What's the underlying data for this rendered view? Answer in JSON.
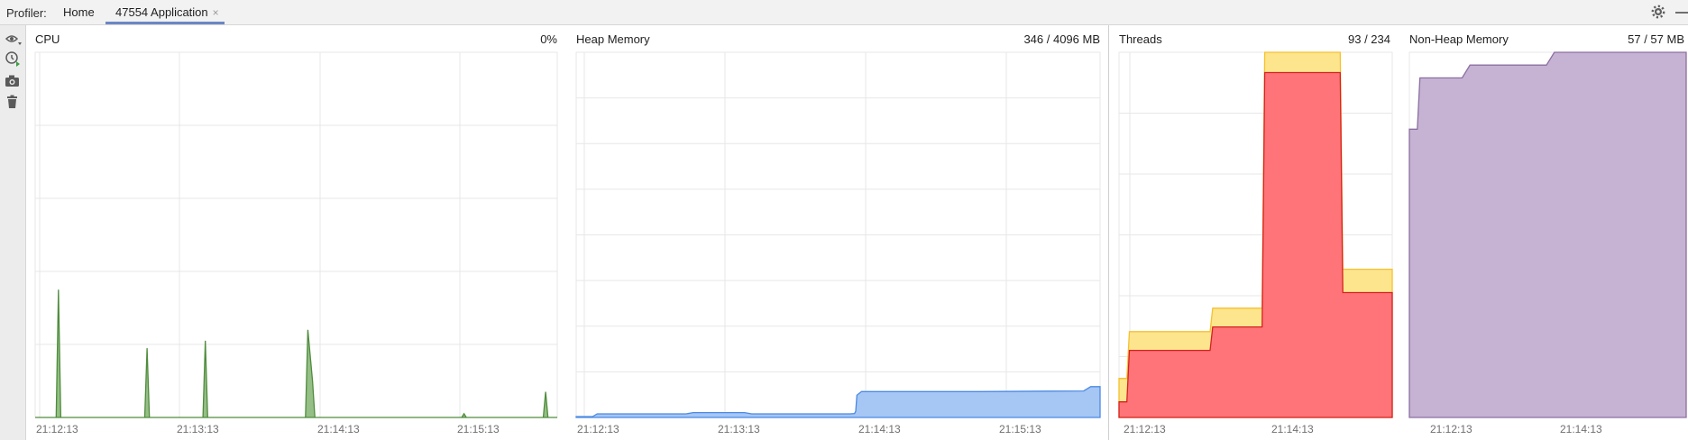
{
  "topbar": {
    "profiler_label": "Profiler:",
    "tabs": [
      {
        "label": "Home"
      },
      {
        "label": "47554 Application",
        "closable": true,
        "active": true
      }
    ],
    "close_glyph": "×"
  },
  "toolbar": {
    "icons": [
      "eye-dropdown-icon",
      "cpu-record-icon",
      "camera-icon",
      "trash-icon"
    ]
  },
  "colors": {
    "cpu_fill": "#95bf87",
    "cpu_line": "#4f8c3c",
    "heap_fill": "#a6c6f4",
    "heap_line": "#4a8ae4",
    "threads_total_fill": "#fde58e",
    "threads_total_line": "#f5c12e",
    "threads_live_fill": "#ff7478",
    "threads_live_line": "#d42121",
    "nonheap_fill": "#c6b2d2",
    "nonheap_line": "#8c6fa2",
    "grid": "#e7e7e7"
  },
  "panels": {
    "cpu": {
      "title": "CPU",
      "value": "0%",
      "ticks": [
        "21:12:13",
        "21:13:13",
        "21:14:13",
        "21:15:13"
      ]
    },
    "heap": {
      "title": "Heap Memory",
      "value": "346 / 4096 MB",
      "ticks": [
        "21:12:13",
        "21:13:13",
        "21:14:13",
        "21:15:13"
      ]
    },
    "threads": {
      "title": "Threads",
      "value": "93 / 234",
      "ticks": [
        "21:12:13",
        "21:14:13"
      ]
    },
    "nonheap": {
      "title": "Non-Heap Memory",
      "value": "57 / 57 MB",
      "ticks": [
        "21:12:13",
        "21:14:13"
      ]
    }
  },
  "chart_data": [
    {
      "type": "area",
      "name": "cpu",
      "unit": "percent",
      "x_unit": "seconds since 21:12:13",
      "xlim": [
        -2,
        222
      ],
      "ylim": [
        0,
        100
      ],
      "points": [
        [
          -2,
          0
        ],
        [
          7,
          0
        ],
        [
          8,
          35
        ],
        [
          9,
          0
        ],
        [
          45,
          0
        ],
        [
          46,
          19
        ],
        [
          47,
          0
        ],
        [
          70,
          0
        ],
        [
          71,
          21
        ],
        [
          72,
          0
        ],
        [
          114,
          0
        ],
        [
          115,
          24
        ],
        [
          117,
          10
        ],
        [
          118,
          0
        ],
        [
          181,
          0
        ],
        [
          182,
          1
        ],
        [
          183,
          0
        ],
        [
          216,
          0
        ],
        [
          217,
          7
        ],
        [
          218,
          0
        ],
        [
          222,
          0
        ]
      ]
    },
    {
      "type": "area",
      "name": "heap",
      "unit": "MB",
      "x_unit": "seconds since 21:12:13",
      "xlim": [
        -2,
        222
      ],
      "ylim": [
        0,
        4096
      ],
      "points": [
        [
          -2,
          10
        ],
        [
          5,
          10
        ],
        [
          7,
          40
        ],
        [
          45,
          40
        ],
        [
          48,
          55
        ],
        [
          70,
          55
        ],
        [
          73,
          40
        ],
        [
          115,
          40
        ],
        [
          117,
          45
        ],
        [
          117.5,
          70
        ],
        [
          118,
          250
        ],
        [
          120,
          290
        ],
        [
          170,
          290
        ],
        [
          200,
          295
        ],
        [
          215,
          297
        ],
        [
          218,
          346
        ],
        [
          222,
          346
        ]
      ]
    },
    {
      "type": "area",
      "name": "threads",
      "x_unit": "seconds since 21:12:13",
      "xlim": [
        -5,
        100
      ],
      "ylim": [
        0,
        234
      ],
      "series": [
        {
          "points": [
            [
              -5,
              25
            ],
            [
              -2,
              25
            ],
            [
              -1,
              55
            ],
            [
              30,
              55
            ],
            [
              31,
              70
            ],
            [
              50,
              70
            ],
            [
              51,
              234
            ],
            [
              80,
              234
            ],
            [
              81,
              95
            ],
            [
              100,
              95
            ]
          ]
        },
        {
          "points": [
            [
              -5,
              10
            ],
            [
              -2,
              10
            ],
            [
              -1,
              43
            ],
            [
              30,
              43
            ],
            [
              31,
              58
            ],
            [
              50,
              58
            ],
            [
              51,
              221
            ],
            [
              80,
              221
            ],
            [
              81,
              80
            ],
            [
              100,
              80
            ]
          ]
        }
      ]
    },
    {
      "type": "area",
      "name": "nonheap",
      "unit": "MB",
      "x_unit": "seconds since 21:12:13",
      "xlim": [
        -5,
        100
      ],
      "ylim": [
        0,
        57
      ],
      "points": [
        [
          -5,
          45
        ],
        [
          -2,
          45
        ],
        [
          -1,
          53
        ],
        [
          15,
          53
        ],
        [
          18,
          55
        ],
        [
          47,
          55
        ],
        [
          50,
          57
        ],
        [
          100,
          57
        ]
      ]
    }
  ]
}
